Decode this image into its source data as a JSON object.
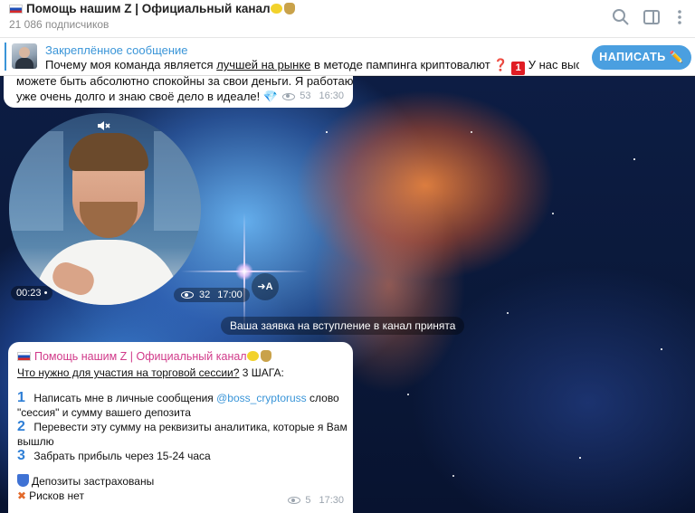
{
  "header": {
    "channel_title": "Помощь нашим Z | Официальный канал",
    "subscribers": "21 086 подписчиков",
    "icons": [
      "search-icon",
      "sidebar-toggle-icon",
      "more-vertical-icon"
    ]
  },
  "pinned": {
    "label": "Закреплённое сообщение",
    "text_before": "Почему моя команда является ",
    "text_underlined": "лучшей на рынке",
    "text_after": " в методе пампинга криптовалют ",
    "emoji_q": "❓",
    "emoji_one": "1",
    "text_tail": " У нас высо...",
    "write_button": "НАПИСАТЬ ✏️"
  },
  "top_message": {
    "line1": "можете быть абсолютно спокойны за свои деньги. Я работаю",
    "line2": "уже очень долго и знаю своё дело в идеале! 💎",
    "views": "53",
    "time": "16:30"
  },
  "video_note": {
    "duration": "00:23",
    "views": "32",
    "time": "17:00",
    "forward_label": "➜A"
  },
  "service_message": "Ваша заявка на вступление в канал принята",
  "main_message": {
    "author": "Помощь нашим Z | Официальный канал",
    "question": "Что нужно для участия на торговой сессии?",
    "question_tail": " 3 ШАГА:",
    "step1_num": "1",
    "step1_a": " Написать мне в личные сообщения ",
    "step1_link": "@boss_cryptoruss",
    "step1_b": " слово",
    "step1_c": "\"сессия\" и сумму вашего депозита",
    "step2_num": "2",
    "step2_a": " Перевести эту сумму на реквизиты аналитика, которые я Вам",
    "step2_b": "вышлю",
    "step3_num": "3",
    "step3": " Забрать прибыль через 15-24 часа",
    "deposits": "Депозиты застрахованы",
    "risks": "Рисков нет",
    "views": "5",
    "time": "17:30"
  },
  "colors": {
    "accent_blue": "#3a95d8",
    "author_pink": "#d13a8a",
    "button_blue": "#4a9fe0"
  }
}
